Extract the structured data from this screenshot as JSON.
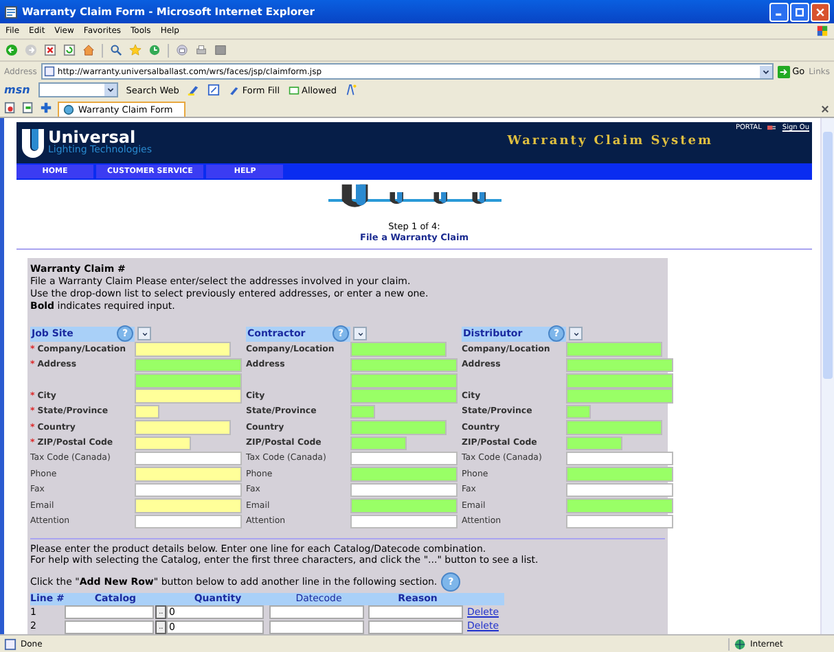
{
  "window": {
    "title": "Warranty Claim Form - Microsoft Internet Explorer"
  },
  "menu": [
    "File",
    "Edit",
    "View",
    "Favorites",
    "Tools",
    "Help"
  ],
  "address": {
    "label": "Address",
    "url": "http://warranty.universalballast.com/wrs/faces/jsp/claimform.jsp",
    "go": "Go",
    "links": "Links"
  },
  "msn_bar": {
    "logo": "msn",
    "search": "Search Web",
    "form_fill": "Form Fill",
    "allowed": "Allowed"
  },
  "tabs": [
    {
      "label": "Warranty Claim Form",
      "selected": true
    }
  ],
  "banner": {
    "logo_name": "Universal",
    "logo_sub": "Lighting Technologies",
    "portal": "PORTAL",
    "sign_out": "Sign Ou",
    "system_title": "Warranty Claim System"
  },
  "nav": [
    "HOME",
    "CUSTOMER SERVICE",
    "HELP"
  ],
  "progress_steps": [
    {
      "selected": true
    },
    {
      "selected": false
    },
    {
      "selected": false
    },
    {
      "selected": false
    }
  ],
  "step_label": "Step 1 of 4:",
  "step_title": "File a Warranty Claim",
  "claim": {
    "heading": "Warranty Claim #",
    "lines": [
      "File a Warranty Claim Please enter/select the addresses involved in your claim.",
      "Use the drop-down list to select previously entered addresses, or enter a new one.",
      "**Bold** indicates required input."
    ]
  },
  "parties": [
    {
      "title": "Job Site",
      "help": "?",
      "rows": [
        {
          "label": "Company/Location",
          "bold": true,
          "marker": "*",
          "fields": [
            {
              "kind": "pending"
            }
          ]
        },
        {
          "label": "Address",
          "bold": true,
          "marker": "*",
          "fields": [
            {
              "kind": "complete"
            },
            {
              "kind": "complete"
            }
          ]
        },
        {
          "label": "City",
          "bold": true,
          "marker": "*",
          "fields": [
            {
              "kind": "pending"
            }
          ]
        },
        {
          "label": "State/Province",
          "bold": true,
          "marker": "*",
          "fields": [
            {
              "kind": "pending"
            }
          ]
        },
        {
          "label": "Country",
          "bold": true,
          "marker": "*",
          "fields": [
            {
              "kind": "pending"
            }
          ]
        },
        {
          "label": "ZIP/Postal Code",
          "bold": true,
          "marker": "*",
          "fields": [
            {
              "kind": "pending"
            }
          ]
        },
        {
          "label": "Tax Code (Canada)",
          "bold": false,
          "fields": [
            {
              "kind": "optional"
            }
          ]
        },
        {
          "label": "Phone",
          "bold": false,
          "fields": [
            {
              "kind": "pending"
            }
          ]
        },
        {
          "label": "Fax",
          "bold": false,
          "fields": [
            {
              "kind": "optional"
            }
          ]
        },
        {
          "label": "Email",
          "bold": false,
          "fields": [
            {
              "kind": "pending"
            }
          ]
        },
        {
          "label": "Attention",
          "bold": false,
          "fields": [
            {
              "kind": "optional"
            }
          ]
        }
      ]
    },
    {
      "title": "Contractor",
      "help": "?",
      "rows": [
        {
          "label": "Company/Location",
          "bold": true,
          "fields": [
            {
              "kind": "complete"
            }
          ]
        },
        {
          "label": "Address",
          "bold": true,
          "fields": [
            {
              "kind": "complete"
            },
            {
              "kind": "complete"
            }
          ]
        },
        {
          "label": "City",
          "bold": true,
          "fields": [
            {
              "kind": "complete"
            }
          ]
        },
        {
          "label": "State/Province",
          "bold": true,
          "fields": [
            {
              "kind": "complete"
            }
          ]
        },
        {
          "label": "Country",
          "bold": true,
          "fields": [
            {
              "kind": "complete"
            }
          ]
        },
        {
          "label": "ZIP/Postal Code",
          "bold": true,
          "fields": [
            {
              "kind": "complete"
            }
          ]
        },
        {
          "label": "Tax Code (Canada)",
          "bold": false,
          "fields": [
            {
              "kind": "optional"
            }
          ]
        },
        {
          "label": "Phone",
          "bold": false,
          "fields": [
            {
              "kind": "complete"
            }
          ]
        },
        {
          "label": "Fax",
          "bold": false,
          "fields": [
            {
              "kind": "optional"
            }
          ]
        },
        {
          "label": "Email",
          "bold": false,
          "fields": [
            {
              "kind": "complete"
            }
          ]
        },
        {
          "label": "Attention",
          "bold": false,
          "fields": [
            {
              "kind": "optional"
            }
          ]
        }
      ]
    },
    {
      "title": "Distributor",
      "help": "?",
      "rows": [
        {
          "label": "Company/Location",
          "bold": true,
          "fields": [
            {
              "kind": "complete"
            }
          ]
        },
        {
          "label": "Address",
          "bold": true,
          "fields": [
            {
              "kind": "complete"
            },
            {
              "kind": "complete"
            }
          ]
        },
        {
          "label": "City",
          "bold": true,
          "fields": [
            {
              "kind": "complete"
            }
          ]
        },
        {
          "label": "State/Province",
          "bold": true,
          "fields": [
            {
              "kind": "complete"
            }
          ]
        },
        {
          "label": "Country",
          "bold": true,
          "fields": [
            {
              "kind": "complete"
            }
          ]
        },
        {
          "label": "ZIP/Postal Code",
          "bold": true,
          "fields": [
            {
              "kind": "complete"
            }
          ]
        },
        {
          "label": "Tax Code (Canada)",
          "bold": false,
          "fields": [
            {
              "kind": "optional"
            }
          ]
        },
        {
          "label": "Phone",
          "bold": false,
          "fields": [
            {
              "kind": "complete"
            }
          ]
        },
        {
          "label": "Fax",
          "bold": false,
          "fields": [
            {
              "kind": "optional"
            }
          ]
        },
        {
          "label": "Email",
          "bold": false,
          "fields": [
            {
              "kind": "complete"
            }
          ]
        },
        {
          "label": "Attention",
          "bold": false,
          "fields": [
            {
              "kind": "optional"
            }
          ]
        }
      ]
    }
  ],
  "products": {
    "lines": [
      "Please enter the product details below. Enter one line for each Catalog/Datecode combination.",
      "For help with selecting the Catalog, enter the first three characters, and click the \"...\" button to see a list."
    ],
    "add_row_note": "Click the \"**Add New Row**\" button below to add another line in the following section.",
    "help": "?",
    "columns": [
      {
        "label": "Line #",
        "bold": true
      },
      {
        "label": "Catalog",
        "bold": true
      },
      {
        "label": "Quantity",
        "bold": true
      },
      {
        "label": "Datecode",
        "bold": false
      },
      {
        "label": "Reason",
        "bold": true
      }
    ],
    "browse": "..",
    "rows": [
      {
        "line": "1",
        "quantity": "0",
        "delete": "Delete"
      },
      {
        "line": "2",
        "quantity": "0",
        "delete": "Delete"
      }
    ]
  },
  "status_bar": {
    "text": "Done",
    "zone": "Internet"
  }
}
